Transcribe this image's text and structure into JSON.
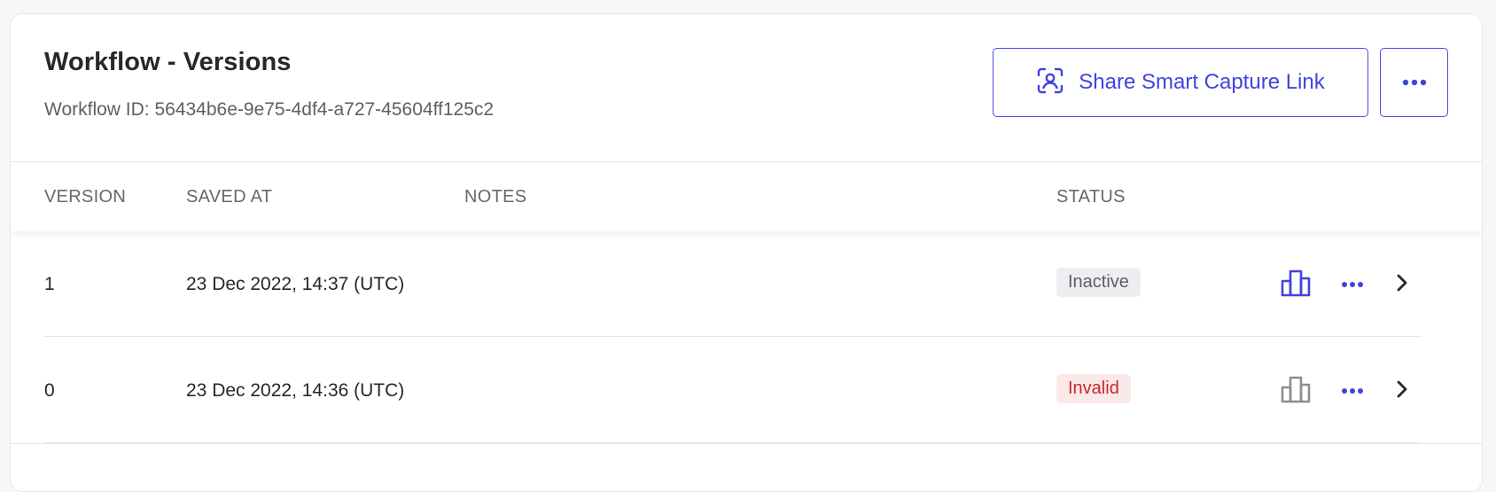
{
  "header": {
    "title": "Workflow - Versions",
    "workflow_id": "Workflow ID: 56434b6e-9e75-4df4-a727-45604ff125c2",
    "share_button_label": "Share Smart Capture Link"
  },
  "table": {
    "columns": [
      "VERSION",
      "SAVED AT",
      "NOTES",
      "STATUS"
    ],
    "rows": [
      {
        "version": "1",
        "saved_at": "23 Dec 2022, 14:37 (UTC)",
        "notes": "",
        "status": "Inactive",
        "analytics_active": true
      },
      {
        "version": "0",
        "saved_at": "23 Dec 2022, 14:36 (UTC)",
        "notes": "",
        "status": "Invalid",
        "analytics_active": false
      }
    ]
  },
  "colors": {
    "accent": "#4044e0",
    "inactive_badge_bg": "#eceef1",
    "invalid_badge_bg": "#fbe8e8",
    "invalid_text": "#c62828",
    "disabled_icon": "#8c8e94"
  },
  "icons": [
    "scan-user-icon",
    "more-horizontal-icon",
    "bar-chart-icon",
    "chevron-right-icon"
  ]
}
